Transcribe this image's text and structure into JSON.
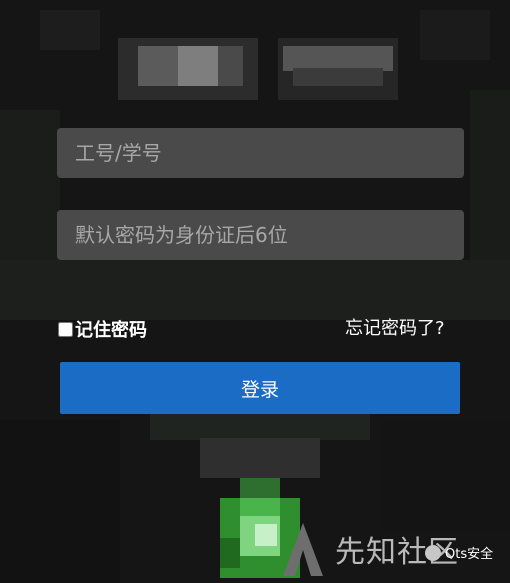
{
  "login": {
    "username_placeholder": "工号/学号",
    "password_placeholder": "默认密码为身份证后6位",
    "remember_label": "记住密码",
    "forgot_label": "忘记密码了?",
    "submit_label": "登录"
  },
  "watermark": {
    "text": "先知社区",
    "badge": "Ots安全"
  },
  "colors": {
    "accent": "#1b6cc4",
    "input_bg": "#4a4a4a",
    "background": "#161616"
  }
}
